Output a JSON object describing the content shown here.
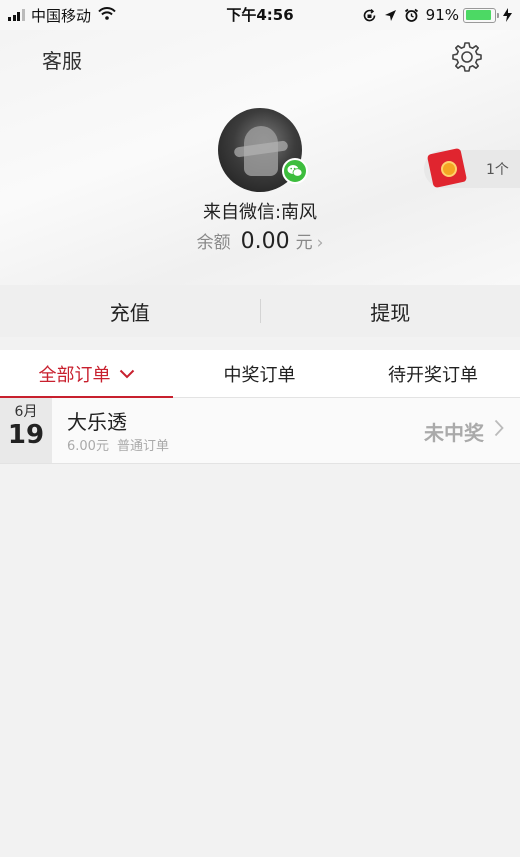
{
  "status_bar": {
    "carrier": "中国移动",
    "time": "下午4:56",
    "battery_percent": "91%",
    "battery_level": 0.91,
    "battery_color": "#4cd964"
  },
  "header": {
    "service_label": "客服",
    "settings_icon": "gear-icon"
  },
  "profile": {
    "nickname": "来自微信:南风",
    "balance_label": "余额",
    "balance_amount": "0.00",
    "balance_unit": "元",
    "balance_arrow": "›",
    "badge_icon": "wechat-icon",
    "badge_color": "#3dbd3d"
  },
  "red_packet": {
    "count": "1个",
    "icon": "red-envelope-icon"
  },
  "actions": {
    "recharge": "充值",
    "withdraw": "提现"
  },
  "tabs": [
    {
      "label": "全部订单",
      "active": true
    },
    {
      "label": "中奖订单",
      "active": false
    },
    {
      "label": "待开奖订单",
      "active": false
    }
  ],
  "accent_color": "#c8202e",
  "orders": [
    {
      "month": "6月",
      "day": "19",
      "title": "大乐透",
      "amount": "6.00元",
      "order_type": "普通订单",
      "status": "未中奖",
      "arrow": "›"
    }
  ]
}
